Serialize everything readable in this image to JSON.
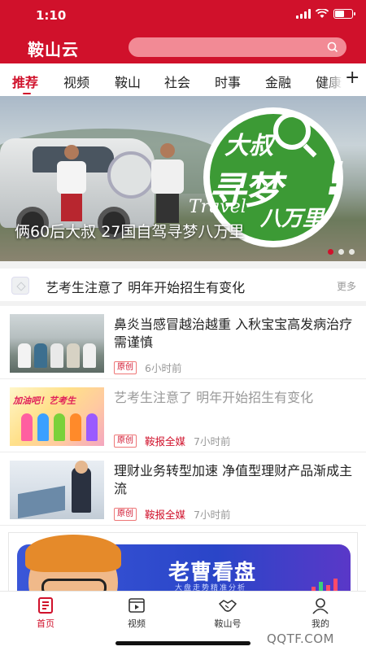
{
  "status_bar": {
    "time": "1:10"
  },
  "header": {
    "logo": "鞍山云"
  },
  "tabs": [
    {
      "label": "推荐",
      "active": true
    },
    {
      "label": "视频"
    },
    {
      "label": "鞍山"
    },
    {
      "label": "社会"
    },
    {
      "label": "时事"
    },
    {
      "label": "金融"
    },
    {
      "label": "健康"
    }
  ],
  "banner": {
    "badge": {
      "line1": "大叔",
      "line2": "寻梦",
      "travel": "Travel",
      "line3": "八万里"
    },
    "caption": "俩60后大叔 27国自驾寻梦八万里",
    "page_count": 3,
    "active_page": 1
  },
  "notice": {
    "text": "艺考生注意了 明年开始招生有变化",
    "more": "更多"
  },
  "articles": [
    {
      "title": "鼻炎当感冒越治越重 入秋宝宝高发病治疗需谨慎",
      "tag": "原创",
      "source": "",
      "time": "6小时前",
      "read": false
    },
    {
      "title": "艺考生注意了 明年开始招生有变化",
      "tag": "原创",
      "source": "鞍报全媒",
      "time": "7小时前",
      "read": true,
      "thumb_text": "加油吧！艺考生"
    },
    {
      "title": "理财业务转型加速 净值型理财产品渐成主流",
      "tag": "原创",
      "source": "鞍报全媒",
      "time": "7小时前",
      "read": false
    }
  ],
  "ad": {
    "title": "老曹看盘",
    "subtitle": "大盘走势精准分析"
  },
  "bottom_nav": [
    {
      "label": "首页",
      "icon": "newspaper-icon",
      "active": true
    },
    {
      "label": "视频",
      "icon": "video-icon"
    },
    {
      "label": "鞍山号",
      "icon": "handshake-icon"
    },
    {
      "label": "我的",
      "icon": "user-icon"
    }
  ],
  "watermark": "QQTF.COM",
  "colors": {
    "brand": "#d0112b",
    "search_bg": "#f28a95",
    "muted": "#999999"
  }
}
